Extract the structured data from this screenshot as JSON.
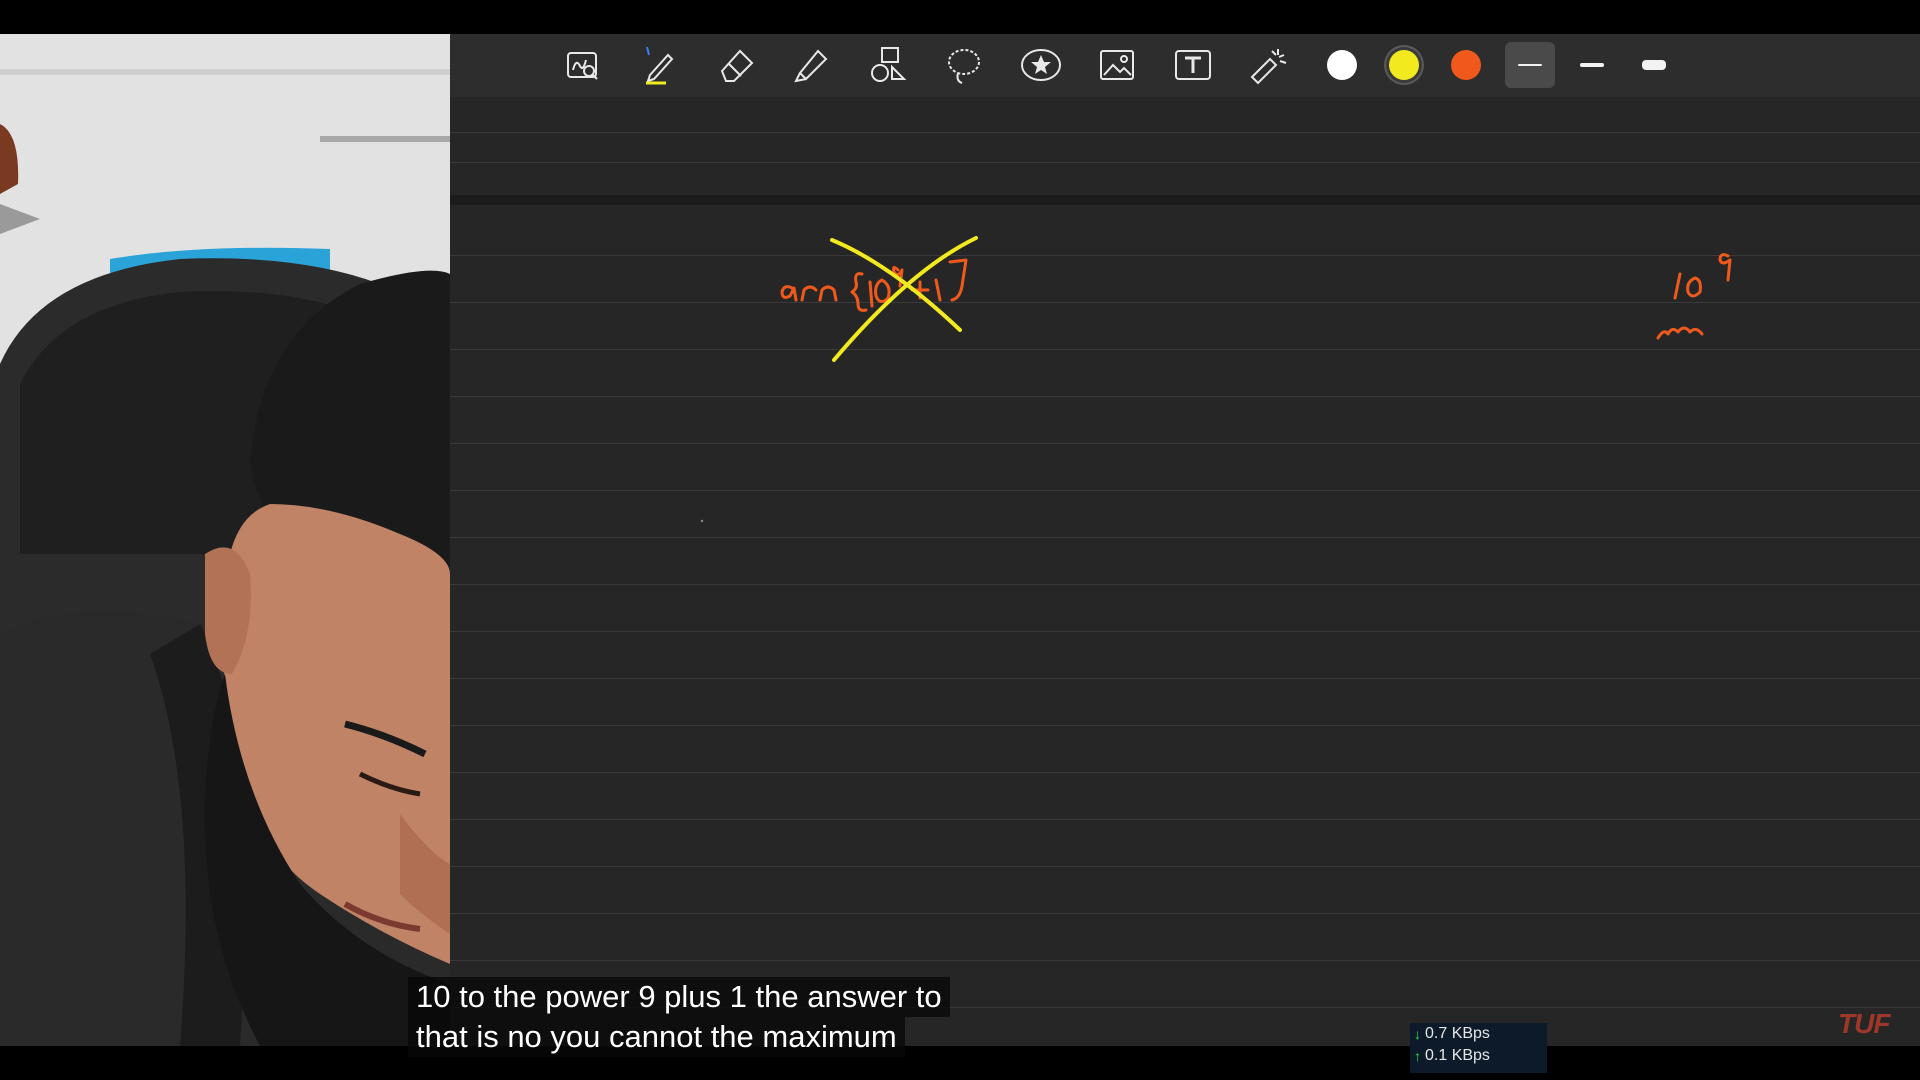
{
  "toolbar": {
    "tools": [
      {
        "name": "zoom-canvas-icon"
      },
      {
        "name": "pen-icon"
      },
      {
        "name": "eraser-icon"
      },
      {
        "name": "highlighter-icon"
      },
      {
        "name": "shapes-icon"
      },
      {
        "name": "lasso-icon"
      },
      {
        "name": "sticker-icon"
      },
      {
        "name": "image-icon"
      },
      {
        "name": "text-box-icon"
      },
      {
        "name": "laser-pointer-icon"
      }
    ],
    "colors": [
      "#ffffff",
      "#f2ea1f",
      "#f0581c"
    ],
    "selected_color": "#f2ea1f",
    "stroke_sizes": [
      "thin",
      "medium",
      "thick"
    ],
    "selected_stroke": "thin"
  },
  "notebook": {
    "background": "#262626",
    "ink_colors": {
      "orange": "#ef5a1c",
      "yellow": "#f2ea1f"
    }
  },
  "captions": {
    "line1": "10 to the power 9 plus 1 the answer to",
    "line2": "that is no you cannot the maximum"
  },
  "network": {
    "download": "0.7 KBps",
    "upload": "0.1 KBps"
  },
  "watermark": "TUF"
}
